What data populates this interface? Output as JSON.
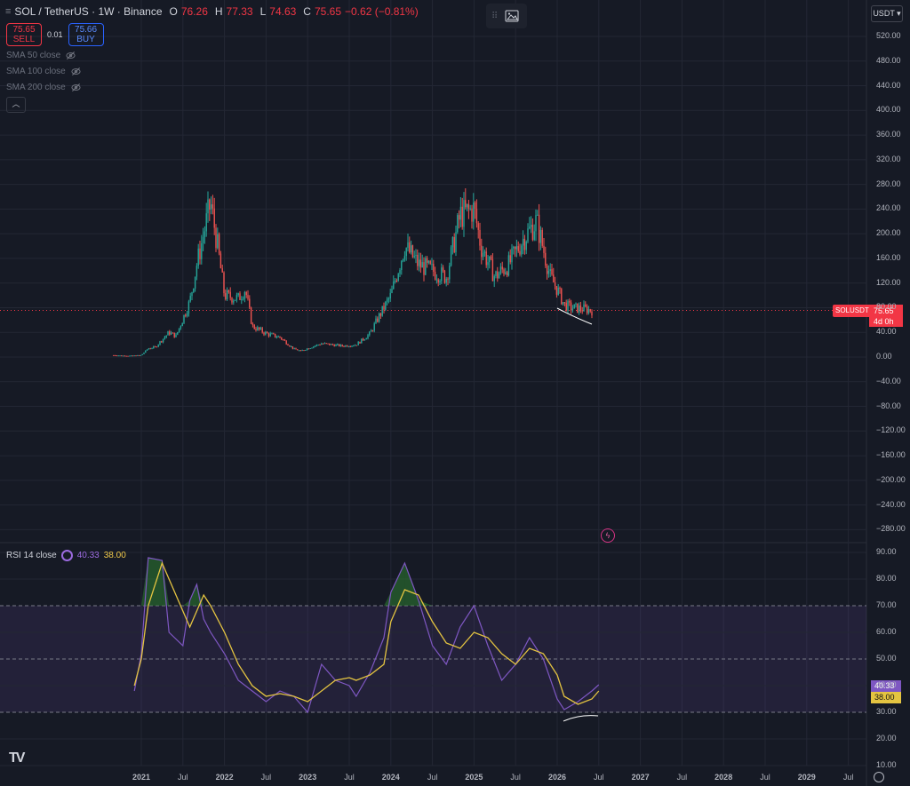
{
  "header": {
    "symbol": "SOL / TetherUS · 1W · Binance",
    "open_key": "O",
    "open": "76.26",
    "high_key": "H",
    "high": "77.33",
    "low_key": "L",
    "low": "74.63",
    "close_key": "C",
    "close": "75.65",
    "change": "−0.62 (−0.81%)"
  },
  "trade": {
    "sell_price": "75.65",
    "sell_label": "SELL",
    "spread": "0.01",
    "buy_price": "75.66",
    "buy_label": "BUY"
  },
  "indicators": [
    "SMA 50 close",
    "SMA 100 close",
    "SMA 200 close"
  ],
  "currency": "USDT",
  "price_tag": {
    "symbol": "SOLUSDT",
    "price": "75.65",
    "countdown": "4d 0h"
  },
  "rsi": {
    "label": "RSI 14 close",
    "value": "40.33",
    "ma_value": "38.00"
  },
  "colors": {
    "up": "#26a69a",
    "down": "#ef5350",
    "rsi": "#7e57c2",
    "rsi_ma": "#e4c441",
    "bg": "#161a25",
    "grid": "#232734"
  },
  "chart_data": [
    {
      "type": "candlestick",
      "title": "SOL / TetherUS · 1W · Binance",
      "xlabel": "",
      "ylabel": "",
      "x_ticks": [
        "2021",
        "Jul",
        "2022",
        "Jul",
        "2023",
        "Jul",
        "2024",
        "Jul",
        "2025",
        "Jul",
        "2026",
        "Jul",
        "2027",
        "Jul",
        "2028",
        "Jul",
        "2029",
        "Jul"
      ],
      "y_ticks": [
        "520.00",
        "480.00",
        "440.00",
        "400.00",
        "360.00",
        "320.00",
        "280.00",
        "240.00",
        "200.00",
        "160.00",
        "120.00",
        "80.00",
        "40.00",
        "0.00",
        "−40.00",
        "−80.00",
        "−120.00",
        "−160.00",
        "−200.00",
        "−240.00",
        "−280.00"
      ],
      "ylim": [
        -300,
        540
      ],
      "x": [
        "2020-09",
        "2020-11",
        "2021-01",
        "2021-02",
        "2021-03",
        "2021-05",
        "2021-06",
        "2021-08",
        "2021-09",
        "2021-11",
        "2021-12",
        "2022-01",
        "2022-03",
        "2022-04",
        "2022-05",
        "2022-07",
        "2022-09",
        "2022-11",
        "2022-12",
        "2023-03",
        "2023-06",
        "2023-08",
        "2023-10",
        "2023-11",
        "2024-01",
        "2024-03",
        "2024-05",
        "2024-07",
        "2024-09",
        "2024-11",
        "2025-01",
        "2025-02",
        "2025-04",
        "2025-06",
        "2025-08",
        "2025-10",
        "2025-12",
        "2026-01",
        "2026-02",
        "2026-03",
        "2026-05",
        "2026-06"
      ],
      "close": [
        3,
        2,
        3,
        14,
        16,
        40,
        34,
        90,
        150,
        250,
        180,
        100,
        95,
        110,
        50,
        38,
        32,
        13,
        10,
        22,
        18,
        20,
        38,
        60,
        100,
        180,
        150,
        140,
        130,
        230,
        240,
        180,
        130,
        150,
        190,
        220,
        130,
        110,
        85,
        80,
        78,
        75.65
      ],
      "grid": true,
      "legend": "none"
    },
    {
      "type": "line",
      "title": "RSI 14 close",
      "y_ticks": [
        "90.00",
        "80.00",
        "70.00",
        "60.00",
        "50.00",
        "40.00",
        "30.00",
        "20.00",
        "10.00"
      ],
      "ylim": [
        10,
        90
      ],
      "bands": [
        30,
        50,
        70
      ],
      "x": [
        "2020-12",
        "2021-01",
        "2021-02",
        "2021-04",
        "2021-05",
        "2021-07",
        "2021-08",
        "2021-09",
        "2021-10",
        "2021-11",
        "2022-01",
        "2022-03",
        "2022-05",
        "2022-07",
        "2022-09",
        "2022-11",
        "2023-01",
        "2023-03",
        "2023-05",
        "2023-07",
        "2023-08",
        "2023-10",
        "2023-12",
        "2024-01",
        "2024-03",
        "2024-05",
        "2024-07",
        "2024-09",
        "2024-11",
        "2025-01",
        "2025-03",
        "2025-05",
        "2025-07",
        "2025-09",
        "2025-11",
        "2026-01",
        "2026-02",
        "2026-04",
        "2026-06",
        "2026-07"
      ],
      "series": [
        {
          "values": [
            38,
            52,
            88,
            87,
            60,
            55,
            72,
            78,
            65,
            60,
            52,
            42,
            38,
            34,
            38,
            36,
            30,
            48,
            42,
            40,
            36,
            45,
            58,
            75,
            86,
            72,
            55,
            48,
            62,
            70,
            55,
            42,
            48,
            58,
            50,
            35,
            31,
            34,
            38,
            40.33
          ]
        },
        {
          "values": [
            40,
            50,
            70,
            86,
            80,
            68,
            62,
            68,
            74,
            70,
            60,
            48,
            40,
            36,
            37,
            36,
            34,
            38,
            42,
            43,
            42,
            44,
            48,
            64,
            76,
            74,
            64,
            56,
            54,
            60,
            58,
            52,
            48,
            54,
            52,
            44,
            36,
            33,
            35,
            38.0
          ]
        }
      ],
      "grid": true,
      "legend": "none"
    }
  ]
}
